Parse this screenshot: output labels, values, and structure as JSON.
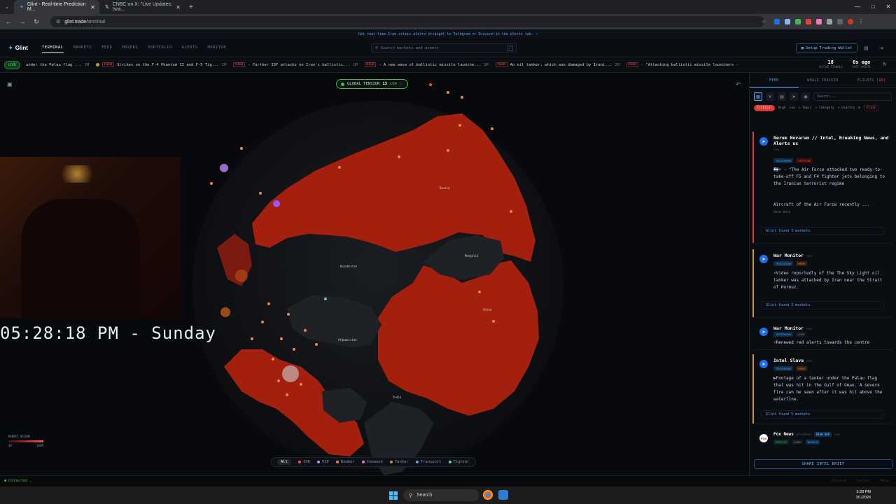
{
  "browser": {
    "tabs": [
      {
        "title": "Glint - Real-time Prediction M...",
        "active": true
      },
      {
        "title": "CNBC on X: \"Live Updates: Isra...",
        "active": false
      }
    ],
    "url_host": "glint.trade",
    "url_path": "/terminal"
  },
  "banner": "Get real-time Iran crisis alerts straight to Telegram or Discord in the alerts tab. →",
  "app": {
    "logo": "Glint",
    "nav": [
      "TERMINAL",
      "MARKETS",
      "FEED",
      "MOVERS",
      "PORTFOLIO",
      "ALERTS",
      "MONITOR"
    ],
    "active_nav": "TERMINAL",
    "search_placeholder": "Search markets and events",
    "search_key": "/",
    "wallet_button": "Setup Trading Wallet"
  },
  "ticker": {
    "live": "LIVE",
    "items": [
      {
        "badge": "",
        "text": "under the Palau flag ...",
        "time": "3M"
      },
      {
        "badge": "HIGH",
        "text": "Strikes on the F-4 Phantom II and F-5 Tig...",
        "time": "1M"
      },
      {
        "badge": "HIGH",
        "text": "- Further IDF attacks on Iran's ballistic...",
        "time": "1M"
      },
      {
        "badge": "HIGH",
        "text": "- A new wave of ballistic missile launche...",
        "time": "1M"
      },
      {
        "badge": "HIGH",
        "text": "An oil tanker, which was damaged by Irani...",
        "time": "2M"
      },
      {
        "badge": "HIGH",
        "text": "- \"Attacking ballistic missile launchers -",
        "time": ""
      }
    ],
    "active_signals_value": "18",
    "active_signals_label": "ACTIVE SIGNALS",
    "last_update_value": "0s ago",
    "last_update_label": "LAST UPDATE"
  },
  "map": {
    "tension_label": "GLOBAL TENSION",
    "tension_value": "13",
    "tension_level": "LOW",
    "clock": "05:28:18 PM - Sunday",
    "market_volume_label": "MARKET VOLUME",
    "market_volume_min": "$0",
    "market_volume_max": "$50M",
    "country_labels": [
      "Russia",
      "Kazakhstan",
      "Mongolia",
      "China",
      "Afghanistan",
      "India"
    ],
    "legend": [
      {
        "label": "All",
        "color": ""
      },
      {
        "label": "ISR",
        "color": "#f85149"
      },
      {
        "label": "VIP",
        "color": "#bc8cff"
      },
      {
        "label": "Bomber",
        "color": "#f0883e"
      },
      {
        "label": "Command",
        "color": "#f778ba"
      },
      {
        "label": "Tanker",
        "color": "#d29922"
      },
      {
        "label": "Transport",
        "color": "#58a6ff"
      },
      {
        "label": "Fighter",
        "color": "#56d4dd"
      }
    ]
  },
  "sidebar": {
    "tabs": [
      {
        "label": "FEED",
        "count": ""
      },
      {
        "label": "WHALE TRACKER",
        "count": ""
      },
      {
        "label": "FLIGHTS",
        "count": "(19)"
      }
    ],
    "search_placeholder": "Search...",
    "filters": [
      "Critical",
      "High",
      "Low",
      "+ Topic",
      "+ Category",
      "+ Country",
      "Clear"
    ],
    "cards": [
      {
        "source": "Rerum Novarum // Intel, Breaking News, and Alerts us",
        "time": "now",
        "tags": [
          "TELEGRAM",
          "CRITICAL"
        ],
        "text": "🇮🇱⚡ - \"The Air Force attacked two ready-to-take-off F5 and F4 fighter jets belonging to the Iranian terrorist regime",
        "text2": "Aircraft of the Air Force recently ...",
        "more": "Show more",
        "markets": "Glint found 3 markets",
        "level": "critical"
      },
      {
        "source": "War Monitor",
        "time": "now",
        "tags": [
          "TELEGRAM",
          "HIGH"
        ],
        "text": "⚡Video reportedly of the The Sky Light oil tanker was attacked by Iran near the Strait of Hormuz.",
        "markets": "Glint found 3 markets",
        "level": "high"
      },
      {
        "source": "War Monitor",
        "time": "now",
        "tags": [
          "TELEGRAM",
          "LOW"
        ],
        "text": "⚡Renewed red alerts towards the centre",
        "level": "low"
      },
      {
        "source": "Intel Slava",
        "time": "now",
        "tags": [
          "TELEGRAM",
          "HIGH"
        ],
        "text": "▶Footage of a tanker under the Palau flag that was hit in the Gulf of Oman. A severe fire can be seen after it was hit above the waterline.",
        "markets": "Glint found 5 markets",
        "level": "high"
      },
      {
        "source": "Fox News",
        "handle": "@FoxNews",
        "badge": "HIGH REP",
        "time": "now",
        "tags": [
          "REPOST",
          "LOW",
          "WORLD"
        ],
        "level": "none"
      }
    ],
    "share_button": "SHARE INTEL BRIEF"
  },
  "status": {
    "connected": "● Connected ⌄",
    "right": [
      "Discord",
      "Twitter",
      "Help"
    ]
  },
  "taskbar": {
    "search": "Search",
    "time": "5:28 PM",
    "date": "3/1/2026"
  }
}
